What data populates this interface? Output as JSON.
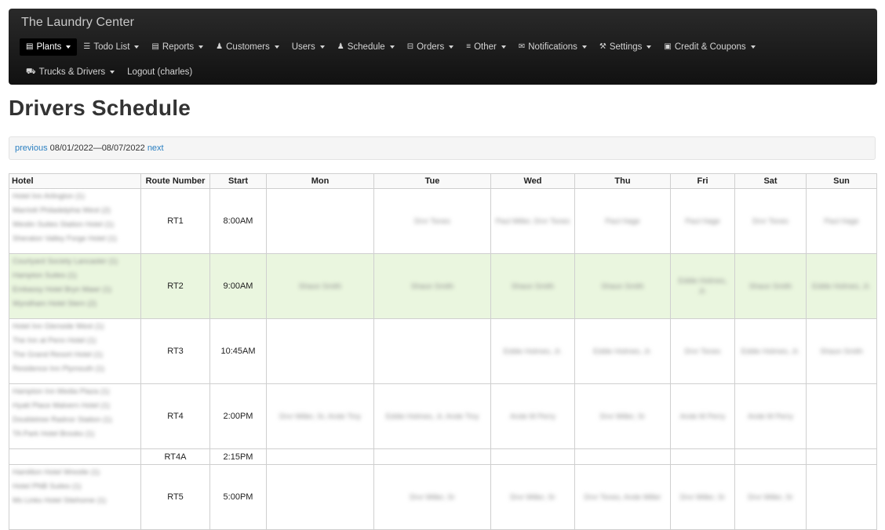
{
  "app": {
    "brand": "The Laundry Center"
  },
  "nav": {
    "row1": [
      {
        "label": "Plants",
        "icon": "plant-icon",
        "glyph": "▤",
        "caret": true,
        "active": true
      },
      {
        "label": "Todo List",
        "icon": "list-icon",
        "glyph": "☰",
        "caret": true,
        "active": false
      },
      {
        "label": "Reports",
        "icon": "reports-icon",
        "glyph": "▤",
        "caret": true,
        "active": false
      },
      {
        "label": "Customers",
        "icon": "user-icon",
        "glyph": "♟",
        "caret": true,
        "active": false
      },
      {
        "label": "Users",
        "icon": "",
        "glyph": "",
        "caret": true,
        "active": false
      },
      {
        "label": "Schedule",
        "icon": "group-icon",
        "glyph": "♟",
        "caret": true,
        "active": false
      },
      {
        "label": "Orders",
        "icon": "cart-icon",
        "glyph": "⊟",
        "caret": true,
        "active": false
      },
      {
        "label": "Other",
        "icon": "menu-icon",
        "glyph": "≡",
        "caret": true,
        "active": false
      },
      {
        "label": "Notifications",
        "icon": "envelope-icon",
        "glyph": "✉",
        "caret": true,
        "active": false
      },
      {
        "label": "Settings",
        "icon": "wrench-icon",
        "glyph": "⚒",
        "caret": true,
        "active": false
      },
      {
        "label": "Credit & Coupons",
        "icon": "money-icon",
        "glyph": "▣",
        "caret": true,
        "active": false
      }
    ],
    "row2": [
      {
        "label": "Trucks & Drivers",
        "icon": "truck-icon",
        "glyph": "⛟",
        "caret": true,
        "active": false
      },
      {
        "label": "Logout (charles)",
        "icon": "",
        "glyph": "",
        "caret": false,
        "active": false
      }
    ]
  },
  "page": {
    "title": "Drivers Schedule"
  },
  "date_nav": {
    "previous": "previous",
    "range": "08/01/2022—08/07/2022",
    "next": "next"
  },
  "table": {
    "headers": [
      "Hotel",
      "Route Number",
      "Start",
      "Mon",
      "Tue",
      "Wed",
      "Thu",
      "Fri",
      "Sat",
      "Sun"
    ],
    "rows": [
      {
        "route": "RT1",
        "start": "8:00AM",
        "highlight": false,
        "size": "big",
        "hotels": [
          "Hotel Inn Arlington (1)",
          "Marriott Philadelphia West (2)",
          "Westin Suites Station Hotel (1)",
          "Sheraton Valley Forge Hotel (1)"
        ],
        "days": [
          "",
          "Drvr Tones",
          "Paul Miller, Drvr Tones",
          "Paul Hage",
          "Paul Hage",
          "Drvr Tones",
          "Paul Hage"
        ]
      },
      {
        "route": "RT2",
        "start": "9:00AM",
        "highlight": true,
        "size": "big",
        "hotels": [
          "Courtyard Society Lancaster (1)",
          "Hampton Suites (1)",
          "Embassy Hotel Bryn Mawr (1)",
          "Wyndham Hotel Stern (2)"
        ],
        "days": [
          "Shaun Smith",
          "Shaun Smith",
          "Shaun Smith",
          "Shaun Smith",
          "Eddie Holmes, Jr.",
          "Shaun Smith",
          "Eddie Holmes, Jr."
        ]
      },
      {
        "route": "RT3",
        "start": "10:45AM",
        "highlight": false,
        "size": "big",
        "hotels": [
          "Hotel Inn Glenside West (1)",
          "The Inn at Penn Hotel (1)",
          "The Grand Resort Hotel (1)",
          "Residence Inn Plymouth (1)"
        ],
        "days": [
          "",
          "",
          "Eddie Holmes, Jr.",
          "Eddie Holmes, Jr.",
          "Drvr Tones",
          "Eddie Holmes, Jr.",
          "Shaun Smith"
        ]
      },
      {
        "route": "RT4",
        "start": "2:00PM",
        "highlight": false,
        "size": "big",
        "hotels": [
          "Hampton Inn Media Plaza (1)",
          "Hyatt Place Malvern Hotel (1)",
          "Doubletree Radnor Station (1)",
          "TA Park Hotel Brooks (1)"
        ],
        "days": [
          "Drvr Miller, Sr, Ande Tiny",
          "Eddie Holmes, Jr, Ande Tiny",
          "Ande M Perry",
          "Drvr Miller, Sr",
          "Ande M Perry",
          "Ande M Perry",
          ""
        ]
      },
      {
        "route": "RT4A",
        "start": "2:15PM",
        "highlight": false,
        "size": "small",
        "hotels": [],
        "days": [
          "",
          "",
          "",
          "",
          "",
          "",
          ""
        ]
      },
      {
        "route": "RT5",
        "start": "5:00PM",
        "highlight": false,
        "size": "big",
        "hotels": [
          "Hamilton Hotel Wrestle (1)",
          "Hotel PNB Suites (1)",
          "Ms Links Hotel Sitehome (1)"
        ],
        "days": [
          "",
          "Drvr Miller, Sr",
          "Drvr Miller, Sr",
          "Drvr Tones, Ande Miller",
          "Drvr Miller, Sr",
          "Drvr Miller, Sr",
          ""
        ]
      }
    ]
  }
}
